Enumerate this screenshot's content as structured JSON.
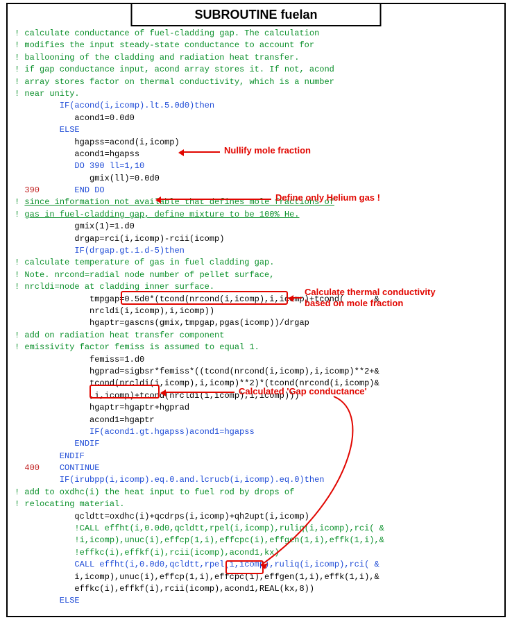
{
  "title": "SUBROUTINE fuelan",
  "annotations": {
    "a1": "Nullify mole fraction",
    "a2": "Define only Helium gas !",
    "a3_l1": "Calculate thermal conductivity",
    "a3_l2": "based on mole fraction",
    "a4": "Calculated 'Gap conductance'"
  },
  "code": {
    "l01": "! calculate conductance of fuel-cladding gap. The calculation",
    "l02": "! modifies the input steady-state conductance to account for",
    "l03": "! ballooning of the cladding and radiation heat transfer.",
    "l04": "! if gap conductance input, acond array stores it. If not, acond",
    "l05": "! array stores factor on thermal conductivity, which is a number",
    "l06": "! near unity.",
    "l07": "         IF(acond(i,icomp).lt.5.0d0)then",
    "l08": "            acond1=0.0d0",
    "l09": "         ELSE",
    "l10": "            hgapss=acond(i,icomp)",
    "l11": "            acond1=hgapss",
    "l12": "            DO 390 ll=1,10",
    "l13": "               gmix(ll)=0.0d0",
    "l14a": "  390",
    "l14b": "       END DO",
    "l15a": "! ",
    "l15b": "since information not available that defines mole fractions of",
    "l16a": "! ",
    "l16b": "gas in fuel-cladding gap, define mixture to be 100% He.",
    "l17": "            gmix(1)=1.d0",
    "l18": "            drgap=rci(i,icomp)-rcii(icomp)",
    "l19": "            IF(drgap.gt.1.d-5)then",
    "l20": "! calculate temperature of gas in fuel cladding gap.",
    "l21": "! Note. nrcond=radial node number of pellet surface,",
    "l22": "! nrcldi=node at cladding inner surface.",
    "l23": "               tmpgap=0.5d0*(tcond(nrcond(i,icomp),i,icomp)+tcond(      &",
    "l24": "               nrcldi(i,icomp),i,icomp))",
    "l25": "               hgaptr=gascns(gmix,tmpgap,pgas(icomp))/drgap",
    "l26": "! add on radiation heat transfer component",
    "l27": "! emissivity factor femiss is assumed to equal 1.",
    "l28": "               femiss=1.d0",
    "l29": "               hgprad=sigbsr*femiss*((tcond(nrcond(i,icomp),i,icomp)**2+&",
    "l30": "               tcond(nrcldi(i,icomp),i,icomp)**2)*(tcond(nrcond(i,icomp)&",
    "l31": "               ,i,icomp)+tcond(nrcldi(i,icomp),i,icomp)))",
    "l32": "               hgaptr=hgaptr+hgprad",
    "l33": "               acond1=hgaptr",
    "l34": "               IF(acond1.gt.hgapss)acond1=hgapss",
    "l35": "            ENDIF",
    "l36": "         ENDIF",
    "l37a": "  400",
    "l37b": "    CONTINUE",
    "l38": "         IF(irubpp(i,icomp).eq.0.and.lcrucb(i,icomp).eq.0)then",
    "l39": "! add to oxdhc(i) the heat input to fuel rod by drops of",
    "l40": "! relocating material.",
    "l41": "            qcldtt=oxdhc(i)+qcdrps(i,icomp)+qh2upt(i,icomp)",
    "l42": "            !CALL effht(i,0.0d0,qcldtt,rpel(i,icomp),ruliq(i,icomp),rci( &",
    "l43": "            !i,icomp),unuc(i),effcp(1,i),effcpc(i),effgen(1,i),effk(1,i),&",
    "l44": "            !effkc(i),effkf(i),rcii(icomp),acond1,kx)",
    "l45": "            CALL effht(i,0.0d0,qcldtt,rpel(i,icomp),ruliq(i,icomp),rci( &",
    "l46": "            i,icomp),unuc(i),effcp(1,i),effcpc(i),effgen(1,i),effk(1,i),&",
    "l47": "            effkc(i),effkf(i),rcii(icomp),acond1,REAL(kx,8))",
    "l48": "         ELSE"
  }
}
